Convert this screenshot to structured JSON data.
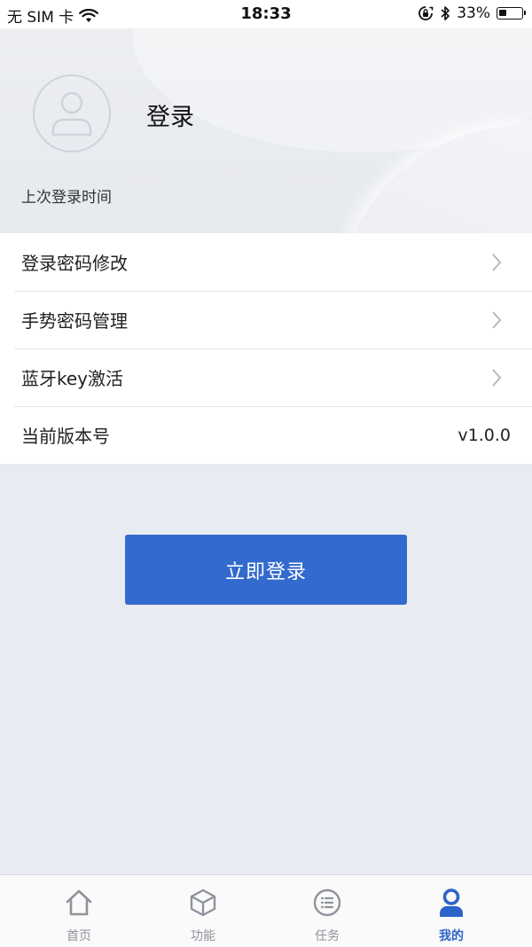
{
  "status_bar": {
    "carrier": "无 SIM 卡",
    "time": "18:33",
    "battery_percent": "33%",
    "battery_level": 0.33
  },
  "header": {
    "title": "登录",
    "last_login_label": "上次登录时间"
  },
  "menu": {
    "items": [
      {
        "label": "登录密码修改",
        "has_chevron": true
      },
      {
        "label": "手势密码管理",
        "has_chevron": true
      },
      {
        "label": "蓝牙key激活",
        "has_chevron": true
      },
      {
        "label": "当前版本号",
        "value": "v1.0.0"
      }
    ]
  },
  "login_button": {
    "label": "立即登录"
  },
  "tab_bar": {
    "tabs": [
      {
        "label": "首页",
        "icon": "home-icon"
      },
      {
        "label": "功能",
        "icon": "cube-icon"
      },
      {
        "label": "任务",
        "icon": "list-icon"
      },
      {
        "label": "我的",
        "icon": "user-icon",
        "active": true
      }
    ]
  },
  "colors": {
    "accent": "#336acd",
    "tab_active": "#2d64c8",
    "tab_inactive": "#8e939c",
    "page_background": "#e8ebf2"
  }
}
